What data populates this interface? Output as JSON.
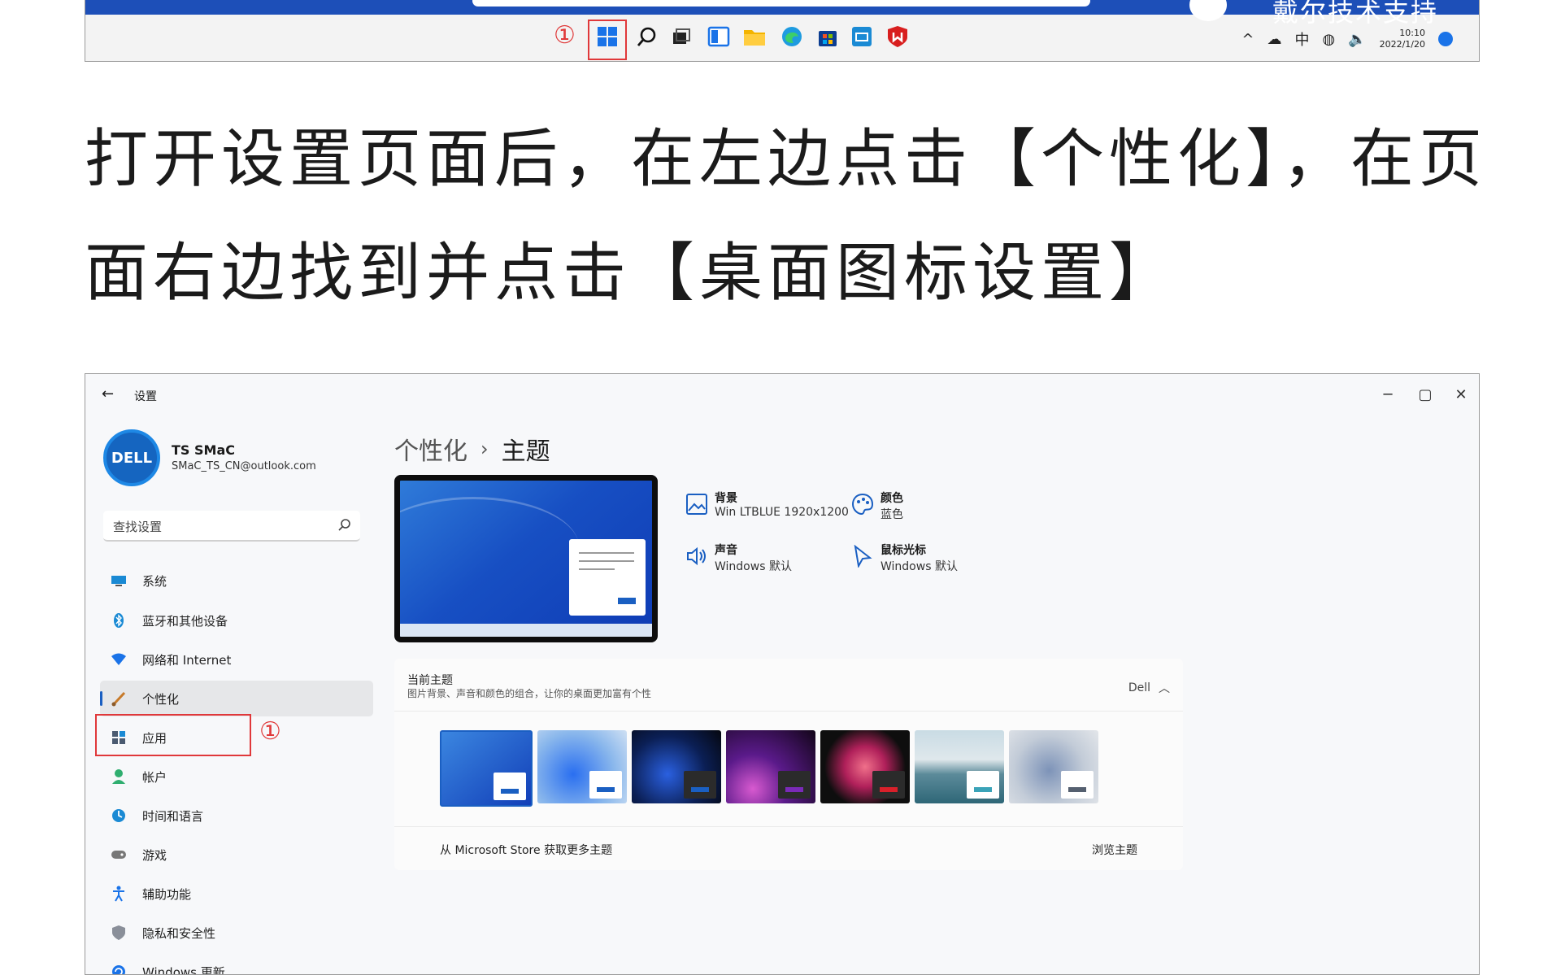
{
  "taskbar": {
    "marker": "①",
    "watermark": "戴尔技术支持",
    "tray_ime": "中",
    "tray_time": "10:10",
    "tray_date": "2022/1/20",
    "icons": [
      "start-icon",
      "search-icon",
      "task-view-icon",
      "widgets-icon",
      "file-explorer-icon",
      "edge-icon",
      "store-icon",
      "mail-icon",
      "mcafee-icon"
    ]
  },
  "instruction": {
    "line1": "打开设置页面后，在左边点击【个性化】，在页",
    "line2": "面右边找到并点击【桌面图标设置】"
  },
  "window": {
    "title": "设置",
    "user": {
      "avatar_text": "DELL",
      "name": "TS SMaC",
      "email": "SMaC_TS_CN@outlook.com"
    },
    "search_placeholder": "查找设置",
    "nav": [
      {
        "label": "系统"
      },
      {
        "label": "蓝牙和其他设备"
      },
      {
        "label": "网络和 Internet"
      },
      {
        "label": "个性化"
      },
      {
        "label": "应用"
      },
      {
        "label": "帐户"
      },
      {
        "label": "时间和语言"
      },
      {
        "label": "游戏"
      },
      {
        "label": "辅助功能"
      },
      {
        "label": "隐私和安全性"
      },
      {
        "label": "Windows 更新"
      }
    ],
    "nav_marker": "①",
    "breadcrumb": {
      "parent": "个性化",
      "sep": "›",
      "current": "主题"
    },
    "props": [
      {
        "title": "背景",
        "value": "Win LTBLUE 1920x1200"
      },
      {
        "title": "颜色",
        "value": "蓝色"
      },
      {
        "title": "声音",
        "value": "Windows 默认"
      },
      {
        "title": "鼠标光标",
        "value": "Windows 默认"
      }
    ],
    "current_theme": {
      "title": "当前主题",
      "desc": "图片背景、声音和颜色的组合，让你的桌面更加富有个性",
      "value": "Dell"
    },
    "store_text": "从 Microsoft Store 获取更多主题",
    "browse_label": "浏览主题"
  },
  "colors": {
    "accent": "#1a5fc2",
    "marker_red": "#e03a3a"
  }
}
